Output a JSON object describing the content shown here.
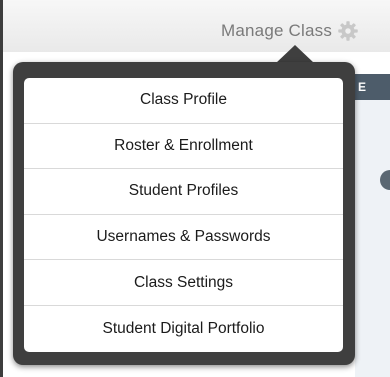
{
  "header": {
    "manage_class_label": "Manage Class",
    "gear_icon": "gear-icon"
  },
  "background": {
    "header_fragment": "E"
  },
  "menu": {
    "items": [
      {
        "label": "Class Profile"
      },
      {
        "label": "Roster & Enrollment"
      },
      {
        "label": "Student Profiles"
      },
      {
        "label": "Usernames & Passwords"
      },
      {
        "label": "Class Settings"
      },
      {
        "label": "Student Digital Portfolio"
      }
    ]
  },
  "colors": {
    "popover_frame": "#3f3f3f",
    "label_gray": "#7a7a7a",
    "background_header": "#4d5c6a"
  }
}
